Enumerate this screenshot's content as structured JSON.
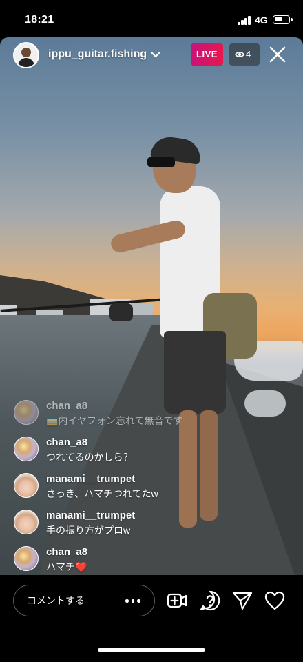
{
  "status_bar": {
    "time": "18:21",
    "network": "4G"
  },
  "header": {
    "username": "ippu_guitar.fishing",
    "live_label": "LIVE",
    "viewer_count": "4",
    "icons": {
      "chevron": "chevron-down-icon",
      "eye": "eye-icon",
      "close": "close-icon"
    },
    "colors": {
      "live_gradient_start": "#c8137a",
      "live_gradient_end": "#e8174e"
    }
  },
  "comments": [
    {
      "user": "chan_a8",
      "text": "🚃内イヤフォン忘れて無音です"
    },
    {
      "user": "chan_a8",
      "text": "つれてるのかしら？"
    },
    {
      "user": "manami__trumpet",
      "text": "さっき、ハマチつれてたw"
    },
    {
      "user": "manami__trumpet",
      "text": "手の振り方がプロw"
    },
    {
      "user": "chan_a8",
      "text": "ハマチ❤️"
    }
  ],
  "bottom_bar": {
    "comment_placeholder": "コメントする",
    "icons": [
      "more-icon",
      "add-video-icon",
      "question-icon",
      "send-icon",
      "heart-icon"
    ]
  }
}
